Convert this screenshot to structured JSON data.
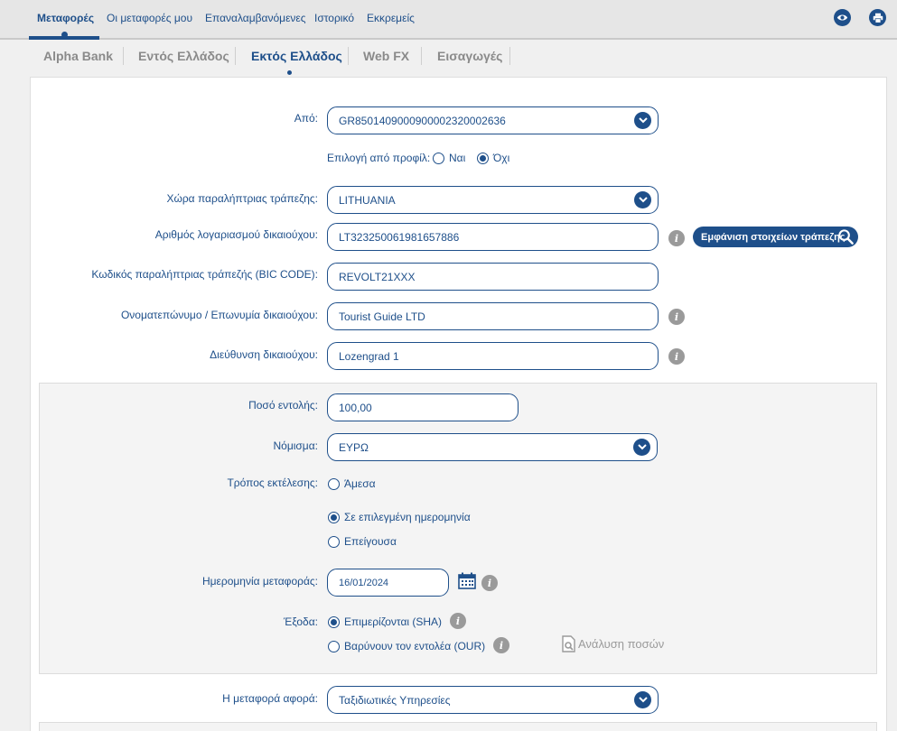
{
  "topnav": {
    "tabs": [
      "Μεταφορές",
      "Οι μεταφορές μου",
      "Επαναλαμβανόμενες",
      "Ιστορικό",
      "Εκκρεμείς"
    ],
    "eye_icon": "eye-icon",
    "print_icon": "printer-icon"
  },
  "subnav": {
    "tabs": [
      "Alpha Bank",
      "Εντός Ελλάδος",
      "Εκτός Ελλάδος",
      "Web FX",
      "Εισαγωγές"
    ],
    "active": "Εκτός Ελλάδος"
  },
  "form": {
    "from": {
      "label": "Από:",
      "value": "GR8501409000900002320002636"
    },
    "profile": {
      "label": "Επιλογή από προφίλ:",
      "yes": "Ναι",
      "no": "Όχι",
      "selected": "Όχι"
    },
    "country": {
      "label": "Χώρα παραλήπτριας τράπεζης:",
      "value": "LITHUANIA"
    },
    "account": {
      "label": "Αριθμός λογαριασμού δικαιούχου:",
      "value": "LT323250061981657886"
    },
    "bank_button": "Εμφάνιση στοιχείων τράπεζης",
    "bic": {
      "label": "Κωδικός παραλήπτριας τράπεζής (BIC CODE):",
      "value": "REVOLT21XXX"
    },
    "name": {
      "label": "Ονοματεπώνυμο / Επωνυμία δικαιούχου:",
      "value": "Tourist Guide LTD"
    },
    "address": {
      "label": "Διεύθυνση δικαιούχου:",
      "value": "Lozengrad 1"
    },
    "amount": {
      "label": "Ποσό εντολής:",
      "value": "100,00"
    },
    "currency": {
      "label": "Νόμισμα:",
      "value": "ΕΥΡΩ"
    },
    "execution": {
      "label": "Τρόπος εκτέλεσης:",
      "options": [
        "Άμεσα",
        "Σε επιλεγμένη ημερομηνία",
        "Επείγουσα"
      ],
      "selected": "Σε επιλεγμένη ημερομηνία"
    },
    "date": {
      "label": "Ημερομηνία μεταφοράς:",
      "value": "16/01/2024"
    },
    "charges": {
      "label": "Έξοδα:",
      "options": [
        "Επιμερίζονται (SHA)",
        "Βαρύνουν τον εντολέα (OUR)"
      ],
      "selected": "Επιμερίζονται (SHA)"
    },
    "analysis": "Ανάλυση ποσών",
    "purpose": {
      "label": "Η μεταφορά αφορά:",
      "value": "Ταξιδιωτικές Υπηρεσίες"
    },
    "info_glyph": "i"
  },
  "colors": {
    "primary": "#1e4f8a",
    "muted": "#9a9a9a"
  }
}
